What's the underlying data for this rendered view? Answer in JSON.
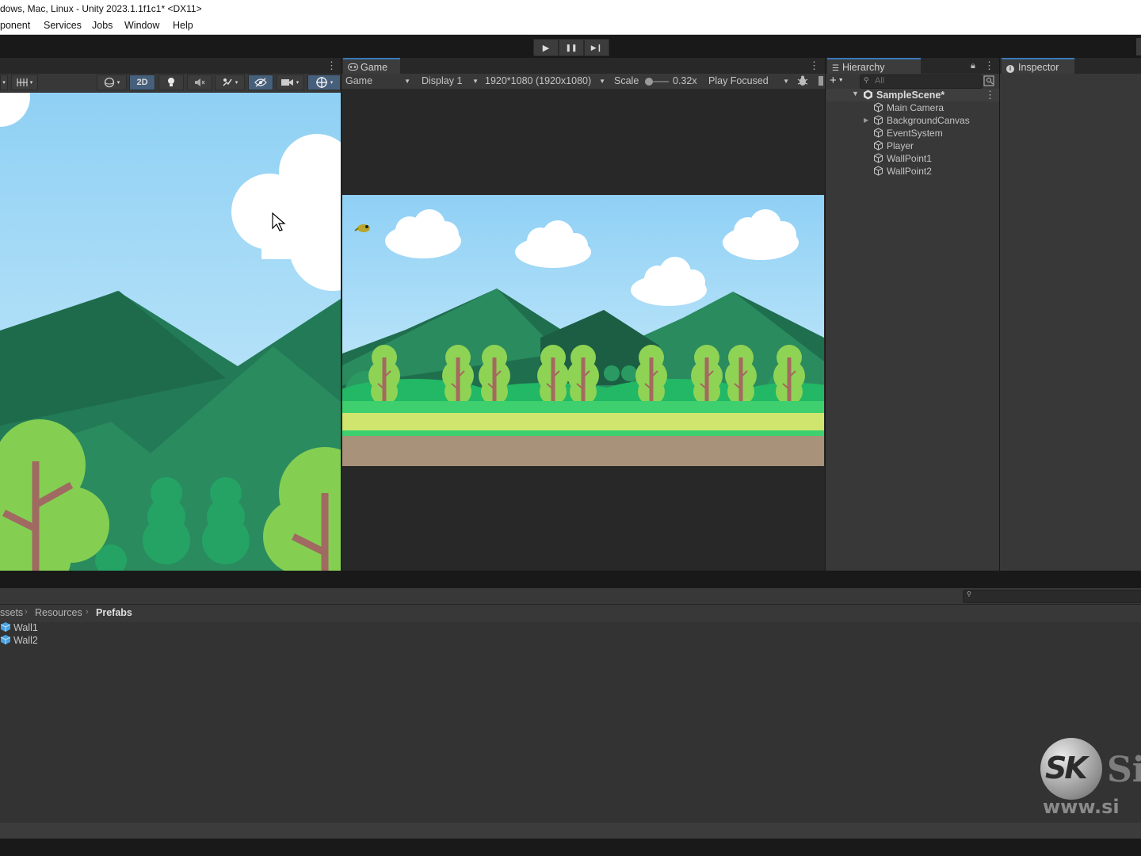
{
  "window_title": "dows, Mac, Linux - Unity 2023.1.1f1c1* <DX11>",
  "menu": [
    "ponent",
    "Services",
    "Jobs",
    "Window",
    "Help"
  ],
  "playback": {
    "play": "▶",
    "pause": "❚❚",
    "step": "▶❙"
  },
  "scene_toolbar": {
    "mode_2d": "2D"
  },
  "game": {
    "tab_label": "Game",
    "view_dropdown": "Game",
    "display_dropdown": "Display 1",
    "resolution_dropdown": "1920*1080 (1920x1080)",
    "scale_label": "Scale",
    "scale_value": "0.32x",
    "scale_level": 0.02,
    "play_mode_dropdown": "Play Focused"
  },
  "hierarchy": {
    "tab_label": "Hierarchy",
    "search_placeholder": "All",
    "scene_name": "SampleScene*",
    "items": [
      "Main Camera",
      "BackgroundCanvas",
      "EventSystem",
      "Player",
      "WallPoint1",
      "WallPoint2"
    ]
  },
  "inspector": {
    "tab_label": "Inspector"
  },
  "project": {
    "breadcrumb": [
      "ssets",
      "Resources",
      "Prefabs"
    ],
    "files": [
      "Wall1",
      "Wall2"
    ]
  },
  "watermark": {
    "brand": "SK",
    "partial_text": "Si",
    "url_partial": "www.si"
  },
  "colors": {
    "accent": "#3a79bb",
    "panel": "#383838",
    "sky": "#a8d8f3"
  }
}
